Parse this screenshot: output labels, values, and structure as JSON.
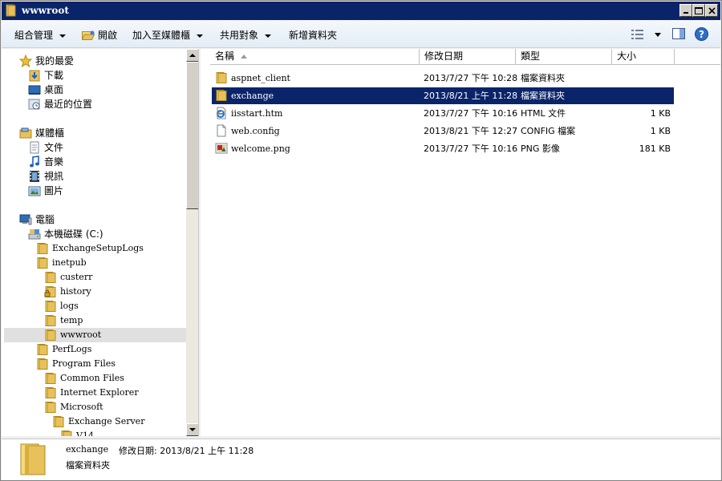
{
  "window": {
    "title": "wwwroot"
  },
  "toolbar": {
    "organize_label": "組合管理",
    "open_label": "開啟",
    "library_label": "加入至媒體櫃",
    "share_label": "共用對象",
    "new_folder_label": "新增資料夾"
  },
  "nav": {
    "favorites": "我的最愛",
    "downloads": "下載",
    "desktop": "桌面",
    "recent": "最近的位置",
    "libraries": "媒體櫃",
    "documents": "文件",
    "music": "音樂",
    "videos": "視訊",
    "pictures": "圖片",
    "computer": "電腦",
    "local_disk": "本機磁碟 (C:)",
    "exchange_setup_logs": "ExchangeSetupLogs",
    "inetpub": "inetpub",
    "custerr": "custerr",
    "history": "history",
    "logs": "logs",
    "temp": "temp",
    "wwwroot": "wwwroot",
    "perflogs": "PerfLogs",
    "program_files": "Program Files",
    "common_files": "Common Files",
    "internet_explorer": "Internet Explorer",
    "microsoft": "Microsoft",
    "exchange_server": "Exchange Server",
    "v14": "V14"
  },
  "columns": {
    "name": "名稱",
    "date": "修改日期",
    "type": "類型",
    "size": "大小"
  },
  "files": [
    {
      "name": "aspnet_client",
      "date": "2013/7/27 下午 10:28",
      "type": "檔案資料夾",
      "size": "",
      "icon": "folder-icon"
    },
    {
      "name": "exchange",
      "date": "2013/8/21 上午 11:28",
      "type": "檔案資料夾",
      "size": "",
      "icon": "folder-icon"
    },
    {
      "name": "iisstart.htm",
      "date": "2013/7/27 下午 10:16",
      "type": "HTML 文件",
      "size": "1 KB",
      "icon": "html-file-icon"
    },
    {
      "name": "web.config",
      "date": "2013/8/21 下午 12:27",
      "type": "CONFIG 檔案",
      "size": "1 KB",
      "icon": "blank-file-icon"
    },
    {
      "name": "welcome.png",
      "date": "2013/7/27 下午 10:16",
      "type": "PNG 影像",
      "size": "181 KB",
      "icon": "image-file-icon"
    }
  ],
  "details": {
    "name": "exchange",
    "modified_label": "修改日期: 2013/8/21 上午 11:28",
    "type": "檔案資料夾"
  },
  "colors": {
    "selection": "#0a246a",
    "titlebar": "#0a246a",
    "folder": "#e8c15a"
  }
}
